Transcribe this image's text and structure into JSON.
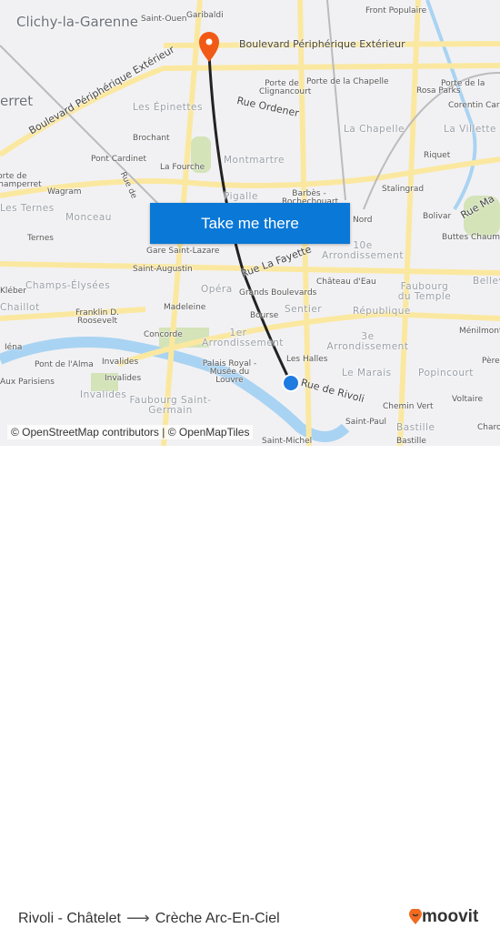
{
  "map": {
    "labels": [
      "Clichy-la-Garenne",
      "Saint-Ouen",
      "Garibaldi",
      "Front Populaire",
      "Boulevard Périphérique Extérieur",
      "Boulevard Périphérique Extérieur",
      "erret",
      "Porte de Clignancourt",
      "Porte de la Chapelle",
      "Rosa Parks",
      "Porte de la",
      "Corentin Cariou",
      "Les Épinettes",
      "Rue Ordener",
      "La Chapelle",
      "La Villette",
      "Brochant",
      "Pont Cardinet",
      "Montmartre",
      "Riquet",
      "La Fourche",
      "Porte de Champerret",
      "Wagram",
      "Rue de",
      "Stalingrad",
      "Pigalle",
      "Barbès - Rochechouart",
      "Les Ternes",
      "Monceau",
      "Bolivar",
      "Nord",
      "Rue Ma",
      "Buttes Chaumont",
      "Ternes",
      "Gare Saint-Lazare",
      "Rue La Fayette",
      "10e Arrondissement",
      "Saint-Augustin",
      "Château d'Eau",
      "Faubourg du Temple",
      "Belleville",
      "Kléber",
      "Champs-Élysées",
      "Opéra",
      "Grands Boulevards",
      "Chaillot",
      "Madeleine",
      "Sentier",
      "République",
      "Franklin D. Roosevelt",
      "Bourse",
      "1er Arrondissement",
      "3e Arrondissement",
      "Concorde",
      "Ménilmontant",
      "Iéna",
      "Pont de l'Alma",
      "Invalides",
      "Les Halles",
      "Palais Royal - Musée du Louvre",
      "Le Marais",
      "Popincourt",
      "Père",
      "Aux Parisiens",
      "Invalides",
      "Rue de Rivoli",
      "Invalides",
      "Faubourg Saint-Germain",
      "Voltaire",
      "Chemin Vert",
      "Saint-Paul",
      "Bastille",
      "Charonne",
      "Saint-Michel",
      "Bastille"
    ],
    "cta_label": "Take me there",
    "attribution": "© OpenStreetMap contributors | © OpenMapTiles",
    "destination_pin_color": "#f05a16",
    "origin_dot_color": "#1e7be0",
    "route_color": "#222222"
  },
  "trip": {
    "from": "Rivoli - Châtelet",
    "arrow": "⟶",
    "to": "Crèche Arc-En-Ciel"
  },
  "brand": {
    "name": "moovit",
    "color": "#f26a20"
  }
}
